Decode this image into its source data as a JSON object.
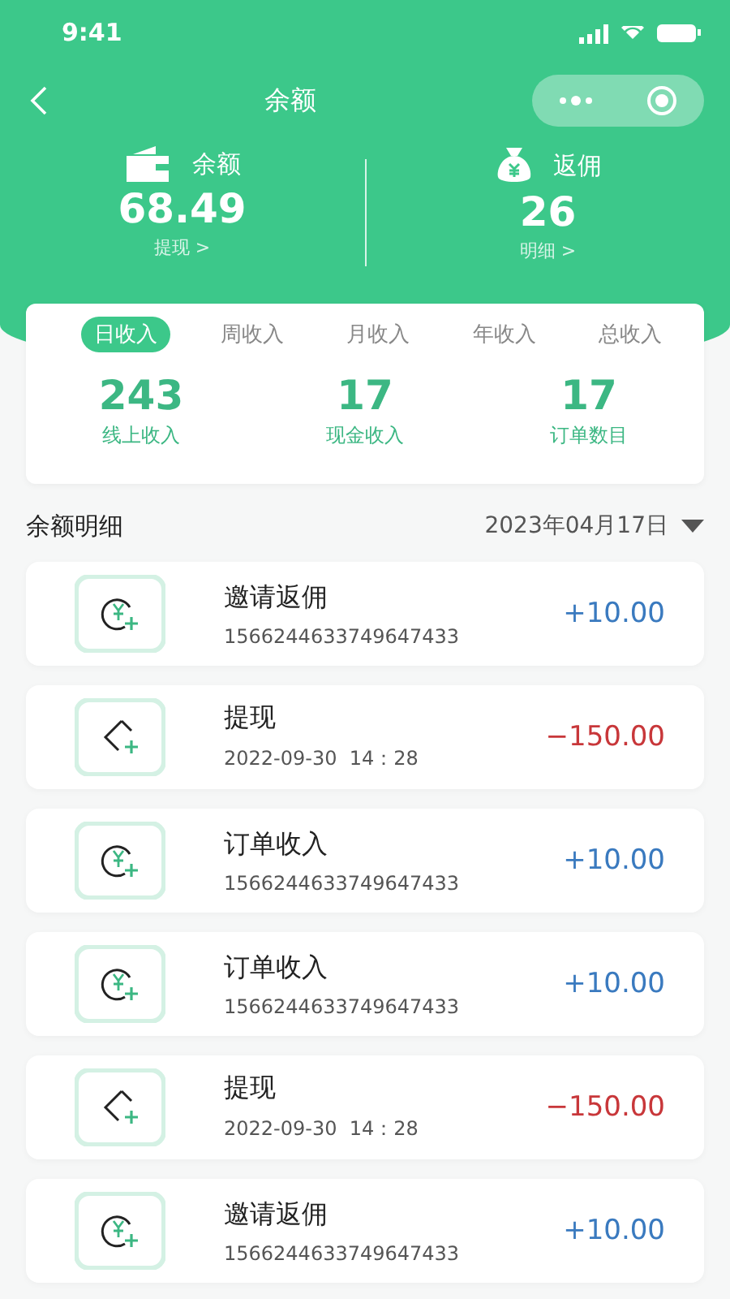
{
  "status_bar": {
    "time": "9:41"
  },
  "nav": {
    "title": "余额"
  },
  "summary": [
    {
      "kind": "wallet",
      "label": "余额",
      "value": "68.49",
      "link": "提现 >"
    },
    {
      "kind": "moneybag",
      "label": "返佣",
      "value": "26",
      "link": "明细 >"
    }
  ],
  "tabs": [
    {
      "label": "日收入",
      "selected": true
    },
    {
      "label": "周收入",
      "selected": false
    },
    {
      "label": "月收入",
      "selected": false
    },
    {
      "label": "年收入",
      "selected": false
    },
    {
      "label": "总收入",
      "selected": false
    }
  ],
  "stats": [
    {
      "value": "243",
      "label": "线上收入"
    },
    {
      "value": "17",
      "label": "现金收入"
    },
    {
      "value": "17",
      "label": "订单数目"
    }
  ],
  "section": {
    "title": "余额明细",
    "date": "2023年04月17日"
  },
  "records": [
    {
      "kind": "income",
      "title": "邀请返佣",
      "detail": "1566244633749647433",
      "amount": "+10.00"
    },
    {
      "kind": "withdraw",
      "title": "提现",
      "detail": "2022-09-30  14：28",
      "amount": "−150.00"
    },
    {
      "kind": "income",
      "title": "订单收入",
      "detail": "1566244633749647433",
      "amount": "+10.00"
    },
    {
      "kind": "income",
      "title": "订单收入",
      "detail": "1566244633749647433",
      "amount": "+10.00"
    },
    {
      "kind": "withdraw",
      "title": "提现",
      "detail": "2022-09-30  14：28",
      "amount": "−150.00"
    },
    {
      "kind": "income",
      "title": "邀请返佣",
      "detail": "1566244633749647433",
      "amount": "+10.00"
    }
  ]
}
